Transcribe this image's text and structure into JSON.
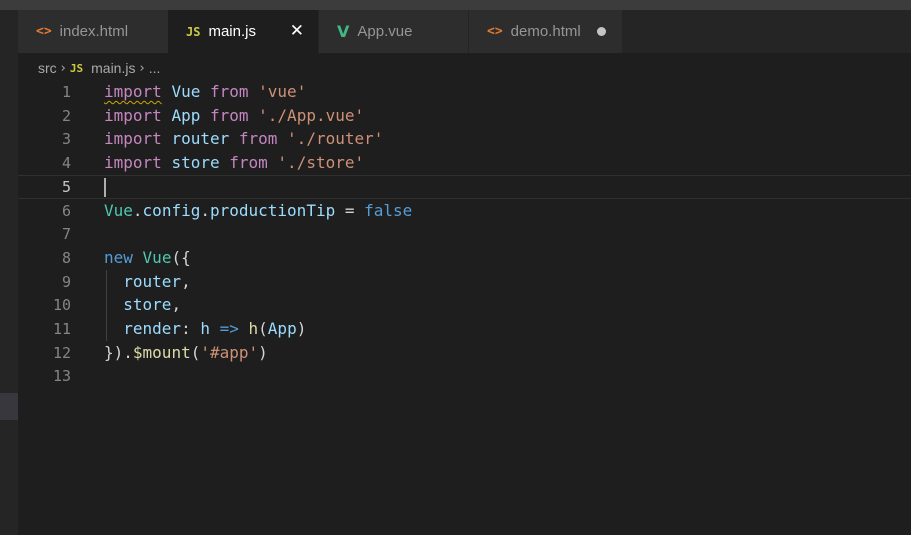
{
  "tabs": [
    {
      "icon": "<>",
      "label": "index.html"
    },
    {
      "icon": "JS",
      "label": "main.js",
      "close": "✕"
    },
    {
      "icon": "V",
      "label": "App.vue"
    },
    {
      "icon": "<>",
      "label": "demo.html"
    }
  ],
  "breadcrumb": {
    "folder": "src",
    "file_icon": "JS",
    "file": "main.js",
    "trail": "..."
  },
  "editor": {
    "current_line": 5,
    "line_numbers": [
      "1",
      "2",
      "3",
      "4",
      "5",
      "6",
      "7",
      "8",
      "9",
      "10",
      "11",
      "12",
      "13"
    ],
    "lines": [
      [
        {
          "t": "import",
          "c": "kw"
        },
        {
          "t": " "
        },
        {
          "t": "Vue",
          "c": "var"
        },
        {
          "t": " "
        },
        {
          "t": "from",
          "c": "kw"
        },
        {
          "t": " "
        },
        {
          "t": "'vue'",
          "c": "str"
        }
      ],
      [
        {
          "t": "import",
          "c": "kw"
        },
        {
          "t": " "
        },
        {
          "t": "App",
          "c": "var"
        },
        {
          "t": " "
        },
        {
          "t": "from",
          "c": "kw"
        },
        {
          "t": " "
        },
        {
          "t": "'./App.vue'",
          "c": "str"
        }
      ],
      [
        {
          "t": "import",
          "c": "kw"
        },
        {
          "t": " "
        },
        {
          "t": "router",
          "c": "var"
        },
        {
          "t": " "
        },
        {
          "t": "from",
          "c": "kw"
        },
        {
          "t": " "
        },
        {
          "t": "'./router'",
          "c": "str"
        }
      ],
      [
        {
          "t": "import",
          "c": "kw"
        },
        {
          "t": " "
        },
        {
          "t": "store",
          "c": "var"
        },
        {
          "t": " "
        },
        {
          "t": "from",
          "c": "kw"
        },
        {
          "t": " "
        },
        {
          "t": "'./store'",
          "c": "str"
        }
      ],
      [],
      [
        {
          "t": "Vue",
          "c": "cls"
        },
        {
          "t": "."
        },
        {
          "t": "config",
          "c": "var"
        },
        {
          "t": "."
        },
        {
          "t": "productionTip",
          "c": "var"
        },
        {
          "t": " = "
        },
        {
          "t": "false",
          "c": "blue"
        }
      ],
      [],
      [
        {
          "t": "new",
          "c": "blue"
        },
        {
          "t": " "
        },
        {
          "t": "Vue",
          "c": "cls"
        },
        {
          "t": "({"
        }
      ],
      [
        {
          "t": "  "
        },
        {
          "t": "router",
          "c": "var"
        },
        {
          "t": ","
        }
      ],
      [
        {
          "t": "  "
        },
        {
          "t": "store",
          "c": "var"
        },
        {
          "t": ","
        }
      ],
      [
        {
          "t": "  "
        },
        {
          "t": "render",
          "c": "var"
        },
        {
          "t": ": "
        },
        {
          "t": "h",
          "c": "var"
        },
        {
          "t": " "
        },
        {
          "t": "=>",
          "c": "blue"
        },
        {
          "t": " "
        },
        {
          "t": "h",
          "c": "fn"
        },
        {
          "t": "("
        },
        {
          "t": "App",
          "c": "var"
        },
        {
          "t": ")"
        }
      ],
      [
        {
          "t": "})."
        },
        {
          "t": "$mount",
          "c": "fn"
        },
        {
          "t": "("
        },
        {
          "t": "'#app'",
          "c": "str"
        },
        {
          "t": ")"
        }
      ],
      []
    ]
  }
}
